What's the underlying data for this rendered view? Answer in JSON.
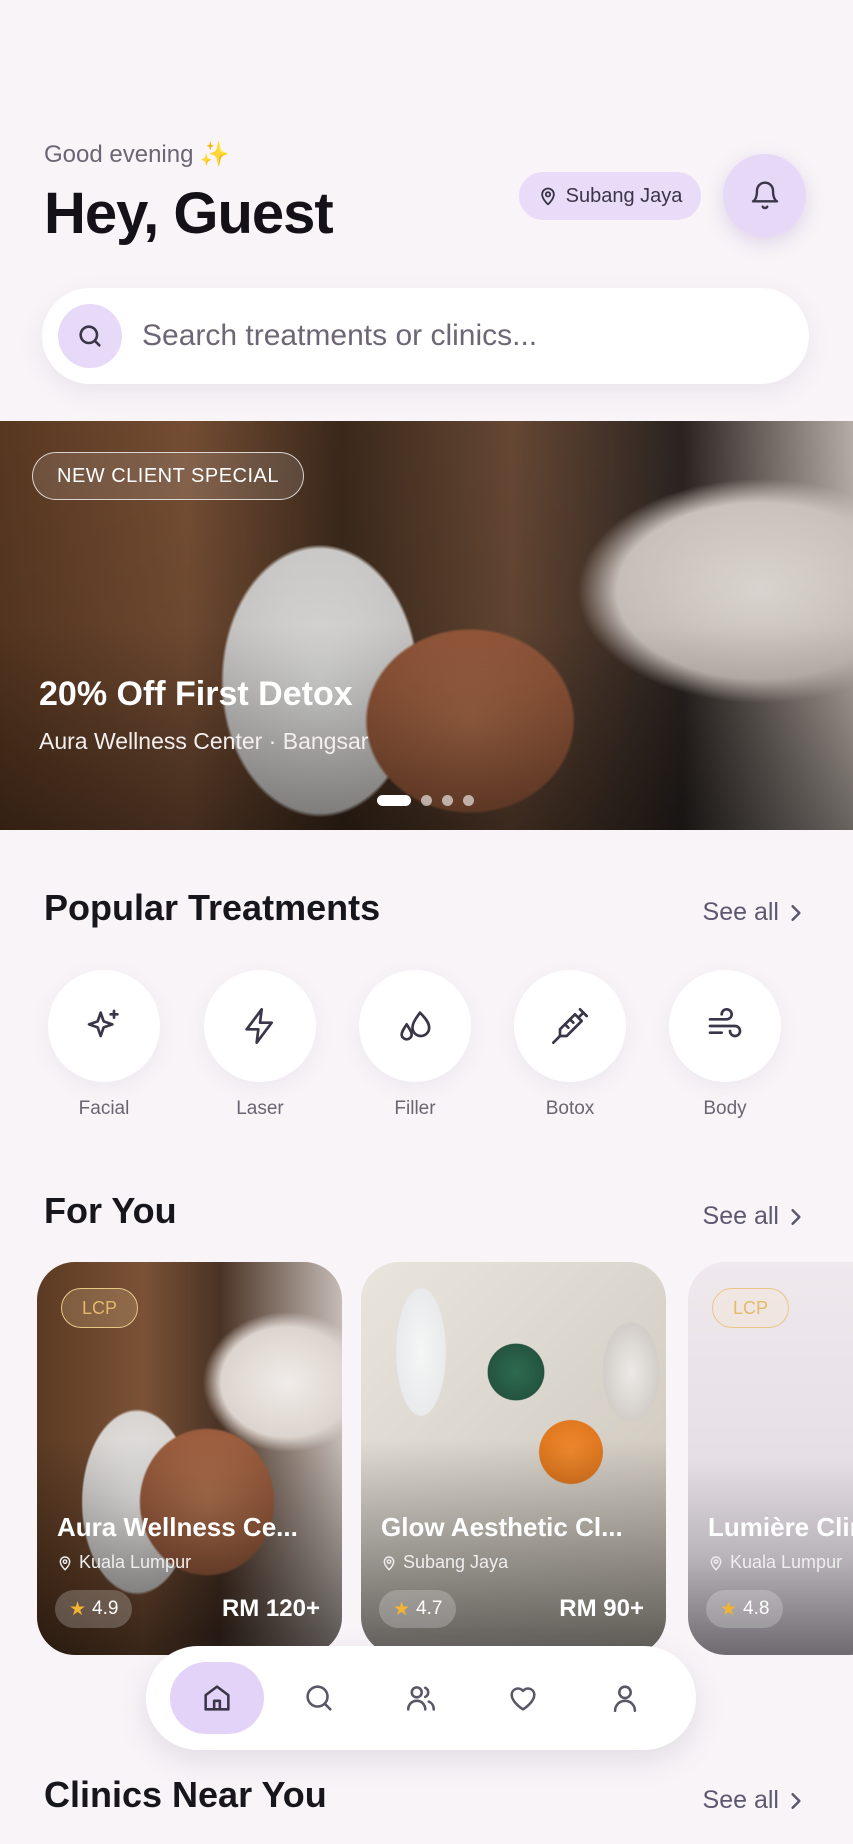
{
  "header": {
    "greeting": "Good evening",
    "greeting_icon": "sparkles-icon",
    "title": "Hey, Guest",
    "location": "Subang Jaya"
  },
  "search": {
    "placeholder": "Search treatments or clinics..."
  },
  "hero": {
    "badge": "NEW CLIENT SPECIAL",
    "title": "20% Off First Detox",
    "subtitle": "Aura Wellness Center · Bangsar",
    "slide_count": 4,
    "active_slide": 1
  },
  "popular": {
    "title": "Popular Treatments",
    "see_all": "See all",
    "items": [
      {
        "label": "Facial",
        "icon": "sparkle-icon"
      },
      {
        "label": "Laser",
        "icon": "lightning-icon"
      },
      {
        "label": "Filler",
        "icon": "droplets-icon"
      },
      {
        "label": "Botox",
        "icon": "syringe-icon"
      },
      {
        "label": "Body",
        "icon": "wind-icon"
      }
    ]
  },
  "for_you": {
    "title": "For You",
    "see_all": "See all",
    "cards": [
      {
        "tag": "LCP",
        "name": "Aura Wellness Ce...",
        "location": "Kuala Lumpur",
        "rating": "4.9",
        "price": "RM 120+"
      },
      {
        "tag": "",
        "name": "Glow Aesthetic Cl...",
        "location": "Subang Jaya",
        "rating": "4.7",
        "price": "RM 90+"
      },
      {
        "tag": "LCP",
        "name": "Lumière Clin",
        "location": "Kuala Lumpur",
        "rating": "4.8",
        "price": ""
      }
    ]
  },
  "clinics_near": {
    "title": "Clinics Near You",
    "see_all": "See all"
  },
  "nav": {
    "items": [
      "home-icon",
      "search-icon",
      "users-icon",
      "heart-icon",
      "profile-icon"
    ],
    "active": "home-icon"
  },
  "colors": {
    "accent": "#e6d9f8",
    "background": "#f8f4f7",
    "star": "#f2b531",
    "tag_gold": "#e3b96a"
  }
}
